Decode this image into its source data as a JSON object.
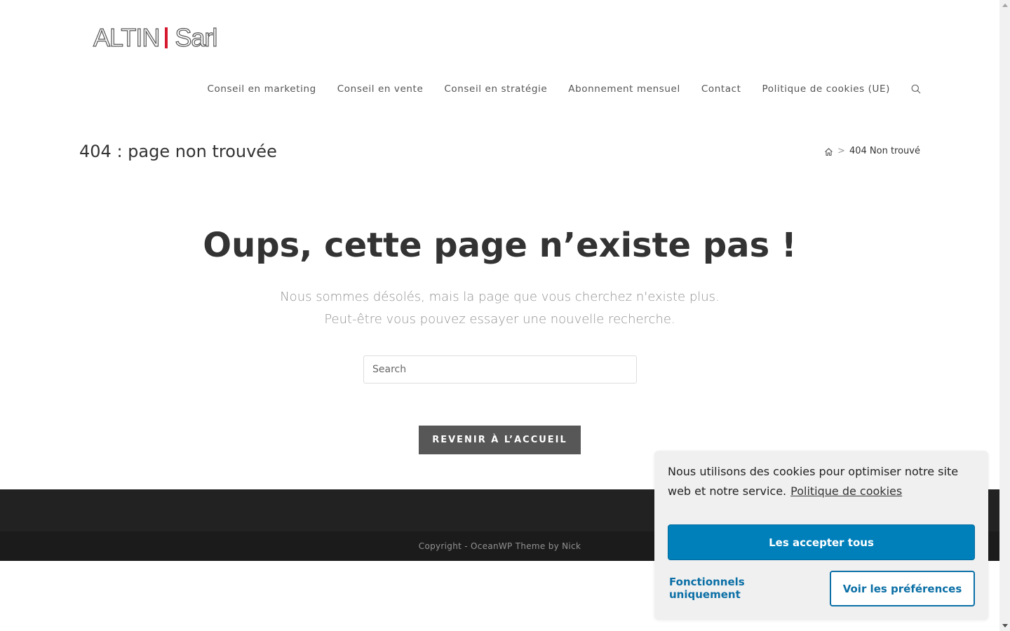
{
  "header": {
    "logo_left": "ALTIN",
    "logo_right": "Sarl",
    "nav": [
      {
        "label": "Conseil en marketing"
      },
      {
        "label": "Conseil en vente"
      },
      {
        "label": "Conseil en stratégie"
      },
      {
        "label": "Abonnement mensuel"
      },
      {
        "label": "Contact"
      },
      {
        "label": "Politique de cookies (UE)"
      }
    ]
  },
  "page_header": {
    "title": "404 : page non trouvée",
    "breadcrumb_separator": ">",
    "breadcrumb_current": "404 Non trouvé"
  },
  "main": {
    "headline": "Oups, cette page n’existe pas !",
    "message_line1": "Nous sommes désolés, mais la page que vous cherchez n'existe plus.",
    "message_line2": "Peut-être vous pouvez essayer une nouvelle recherche.",
    "search_placeholder": "Search",
    "home_button": "REVENIR À L’ACCUEIL"
  },
  "footer": {
    "copyright": "Copyright - OceanWP Theme by Nick"
  },
  "cookie_banner": {
    "text": "Nous utilisons des cookies pour optimiser notre site web et notre service.",
    "policy_link": "Politique de cookies",
    "accept_all": "Les accepter tous",
    "functional_only": "Fonctionnels uniquement",
    "preferences": "Voir les préférences"
  },
  "colors": {
    "accent_red": "#d7192f",
    "cookie_blue": "#0080bb",
    "footer_dark": "#222222",
    "button_grey": "#575757"
  },
  "icons": {
    "search": "search-icon",
    "home": "home-icon"
  }
}
